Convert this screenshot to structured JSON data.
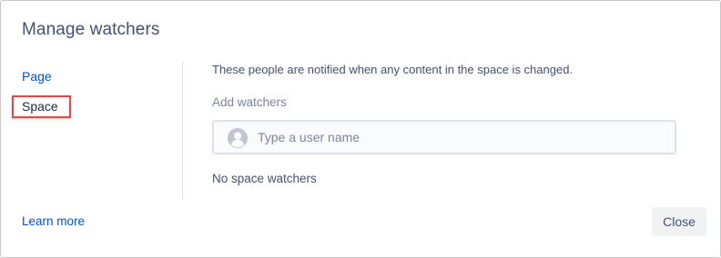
{
  "dialog": {
    "title": "Manage watchers"
  },
  "nav": {
    "items": [
      {
        "label": "Page",
        "selected": false
      },
      {
        "label": "Space",
        "selected": true
      }
    ]
  },
  "main": {
    "description": "These people are notified when any content in the space is changed.",
    "add_label": "Add watchers",
    "input_placeholder": "Type a user name",
    "input_value": "",
    "empty_text": "No space watchers"
  },
  "footer": {
    "learn_more": "Learn more",
    "close_label": "Close"
  },
  "icons": {
    "avatar": "user-avatar-icon"
  },
  "colors": {
    "link": "#0052cc",
    "highlight": "#e8474a",
    "text": "#172b4d",
    "muted": "#7a869a"
  }
}
